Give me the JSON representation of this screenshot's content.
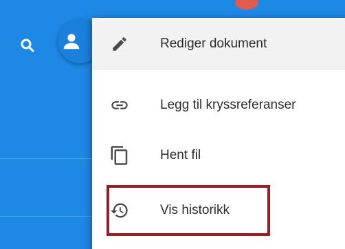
{
  "appbar": {
    "search_icon": "search-icon",
    "avatar_icon": "person-icon",
    "color": "#1e88e5"
  },
  "menu": {
    "items": [
      {
        "label": "Rediger dokument",
        "icon": "pencil-icon"
      },
      {
        "label": "Legg til kryssreferanser",
        "icon": "link-icon"
      },
      {
        "label": "Hent fil",
        "icon": "copy-icon"
      },
      {
        "label": "Vis historikk",
        "icon": "history-icon"
      }
    ]
  },
  "highlight": {
    "target": "Vis historikk",
    "color": "#9b1c24"
  }
}
